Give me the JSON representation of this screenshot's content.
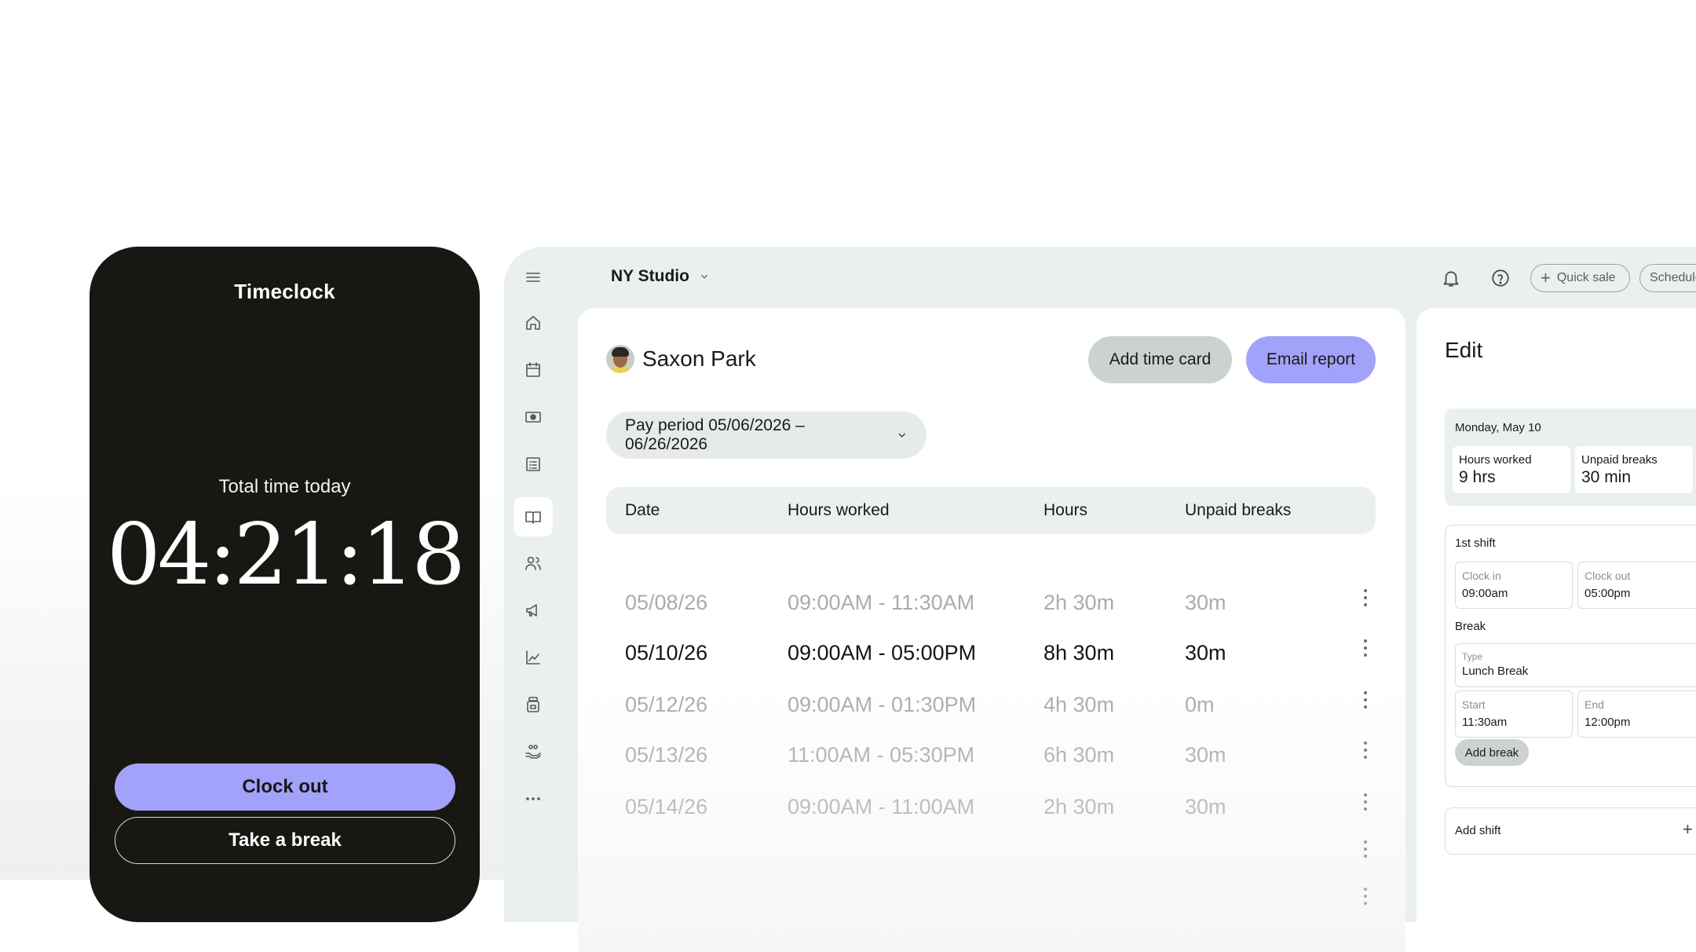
{
  "phone": {
    "title": "Timeclock",
    "total_label": "Total time today",
    "timer": "04:21:18",
    "clock_out": "Clock out",
    "take_break": "Take a break"
  },
  "header": {
    "location": "NY Studio",
    "quick_sale": "Quick sale",
    "schedule": "Schedule"
  },
  "sidebar": {
    "items": [
      {
        "icon": "home-icon"
      },
      {
        "icon": "calendar-icon"
      },
      {
        "icon": "money-icon"
      },
      {
        "icon": "list-icon"
      },
      {
        "icon": "book-icon",
        "active": true
      },
      {
        "icon": "people-icon"
      },
      {
        "icon": "megaphone-icon"
      },
      {
        "icon": "chart-icon"
      },
      {
        "icon": "product-icon"
      },
      {
        "icon": "hand-icon"
      },
      {
        "icon": "more-icon"
      }
    ]
  },
  "timecard": {
    "employee": "Saxon Park",
    "add_time_card": "Add time card",
    "email_report": "Email report",
    "pay_period": "Pay period 05/06/2026 – 06/26/2026",
    "columns": [
      "Date",
      "Hours worked",
      "Hours",
      "Unpaid breaks"
    ],
    "rows": [
      {
        "date": "05/08/26",
        "worked": "09:00AM - 11:30AM",
        "hours": "2h 30m",
        "breaks": "30m"
      },
      {
        "date": "05/10/26",
        "worked": "09:00AM - 05:00PM",
        "hours": "8h 30m",
        "breaks": "30m",
        "selected": true
      },
      {
        "date": "05/12/26",
        "worked": "09:00AM - 01:30PM",
        "hours": "4h 30m",
        "breaks": "0m"
      },
      {
        "date": "05/13/26",
        "worked": "11:00AM - 05:30PM",
        "hours": "6h 30m",
        "breaks": "30m"
      },
      {
        "date": "05/14/26",
        "worked": "09:00AM - 11:00AM",
        "hours": "2h 30m",
        "breaks": "30m"
      }
    ]
  },
  "edit": {
    "title": "Edit",
    "day": "Monday, May 10",
    "hours_worked_label": "Hours worked",
    "hours_worked_value": "9 hrs",
    "unpaid_breaks_label": "Unpaid breaks",
    "unpaid_breaks_value": "30 min",
    "shift_label": "1st shift",
    "clock_in_label": "Clock in",
    "clock_in_value": "09:00am",
    "clock_out_label": "Clock out",
    "clock_out_value": "05:00pm",
    "break_label": "Break",
    "type_label": "Type",
    "type_value": "Lunch Break",
    "start_label": "Start",
    "start_value": "11:30am",
    "end_label": "End",
    "end_value": "12:00pm",
    "add_break": "Add break",
    "add_shift": "Add shift",
    "add_shift_plus": "+"
  },
  "colors": {
    "accent": "#a2a2fa",
    "phone_bg": "#181713",
    "app_bg": "#e9f0ee"
  }
}
